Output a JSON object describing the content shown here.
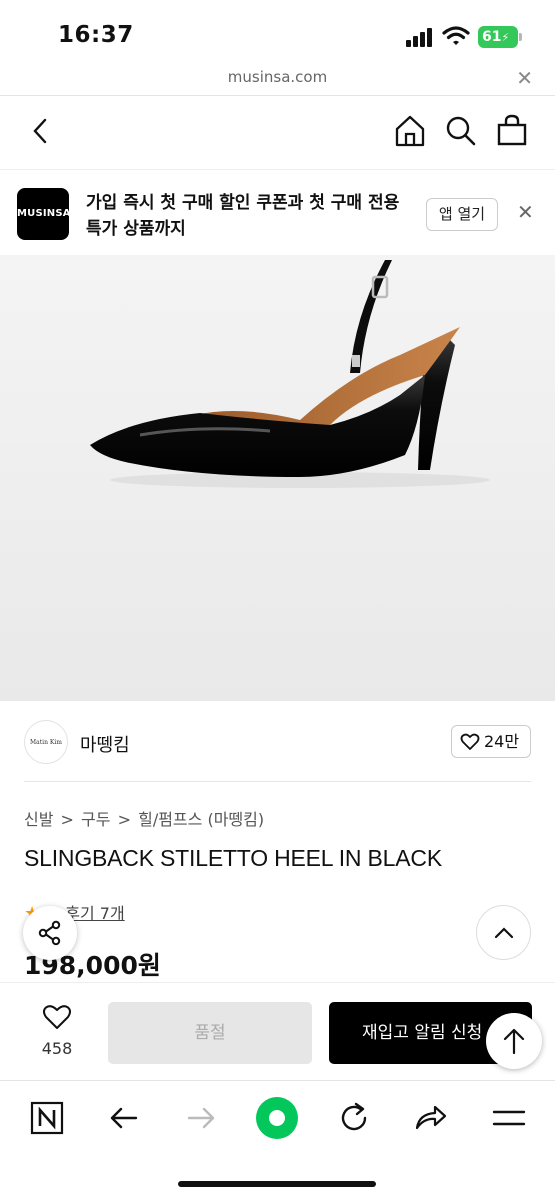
{
  "status_bar": {
    "time": "16:37",
    "battery": "61"
  },
  "url_bar": {
    "url": "musinsa.com",
    "close_icon": "close-icon"
  },
  "top_nav": {
    "icons": [
      "back-icon",
      "home-icon",
      "search-icon",
      "bag-icon"
    ]
  },
  "app_banner": {
    "logo_text": "MUSINSA",
    "message": "가입 즉시 첫 구매 할인 쿠폰과 첫 구매 전용 특가 상품까지",
    "open_button": "앱 열기"
  },
  "brand": {
    "logo_text": "Matin Kim",
    "name": "마뗑킴",
    "like_count": "24만"
  },
  "breadcrumb": [
    "신발",
    ">",
    "구두",
    ">",
    "힐/펌프스 (마뗑킴)"
  ],
  "product": {
    "title": "SLINGBACK STILETTO HEEL IN BLACK",
    "review_text": "후기 7개",
    "price": "198,000원"
  },
  "action_bar": {
    "wish_count": "458",
    "soldout_label": "품절",
    "restock_label": "재입고 알림 신청"
  },
  "browser_toolbar": {
    "icons": [
      "naver-n-icon",
      "back-arrow-icon",
      "forward-arrow-icon",
      "green-dot-icon",
      "reload-icon",
      "share-icon",
      "menu-icon"
    ]
  },
  "colors": {
    "accent_green": "#03c75a",
    "battery_green": "#34c759",
    "star": "#ff9f00"
  }
}
